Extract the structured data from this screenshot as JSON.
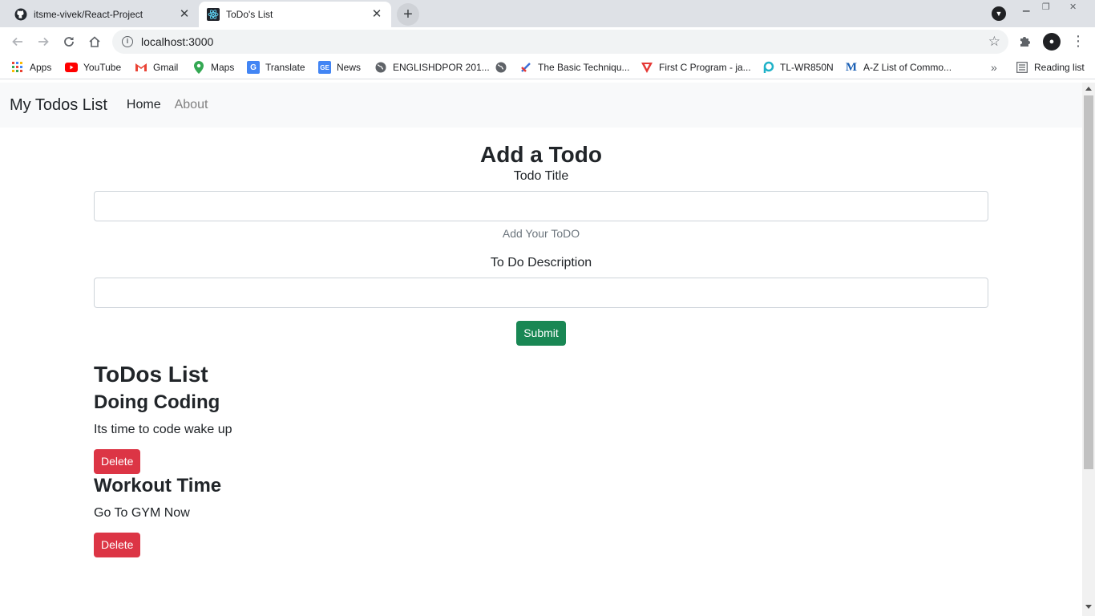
{
  "browser": {
    "tabs": [
      {
        "title": "itsme-vivek/React-Project",
        "icon": "github-icon",
        "active": false
      },
      {
        "title": "ToDo's List",
        "icon": "react-icon",
        "active": true
      }
    ],
    "url": "localhost:3000",
    "bookmarks": [
      {
        "label": "Apps",
        "icon": "apps-grid-icon"
      },
      {
        "label": "YouTube",
        "icon": "youtube-icon"
      },
      {
        "label": "Gmail",
        "icon": "gmail-icon"
      },
      {
        "label": "Maps",
        "icon": "maps-icon"
      },
      {
        "label": "Translate",
        "icon": "translate-icon"
      },
      {
        "label": "News",
        "icon": "news-icon"
      },
      {
        "label": "ENGLISHDPOR 201...",
        "icon": "globe-icon"
      },
      {
        "label": "",
        "icon": "globe-icon"
      },
      {
        "label": "The Basic Techniqu...",
        "icon": "link-icon"
      },
      {
        "label": "First C Program - ja...",
        "icon": "triangle-icon"
      },
      {
        "label": "TL-WR850N",
        "icon": "router-icon"
      },
      {
        "label": "A-Z List of Commo...",
        "icon": "m-icon"
      }
    ],
    "overflow": "»",
    "reading_list": "Reading list"
  },
  "app": {
    "brand": "My Todos List",
    "nav": {
      "home": "Home",
      "about": "About"
    },
    "form": {
      "heading": "Add a Todo",
      "title_label": "Todo Title",
      "title_value": "",
      "title_help": "Add Your ToDO",
      "desc_label": "To Do Description",
      "desc_value": "",
      "submit": "Submit"
    },
    "list_heading": "ToDos List",
    "todos": [
      {
        "title": "Doing Coding",
        "desc": "Its time to code wake up",
        "delete": "Delete"
      },
      {
        "title": "Workout Time",
        "desc": "Go To GYM Now",
        "delete": "Delete"
      }
    ]
  },
  "colors": {
    "success": "#198754",
    "danger": "#dc3545",
    "navbar_bg": "#f8f9fa"
  }
}
